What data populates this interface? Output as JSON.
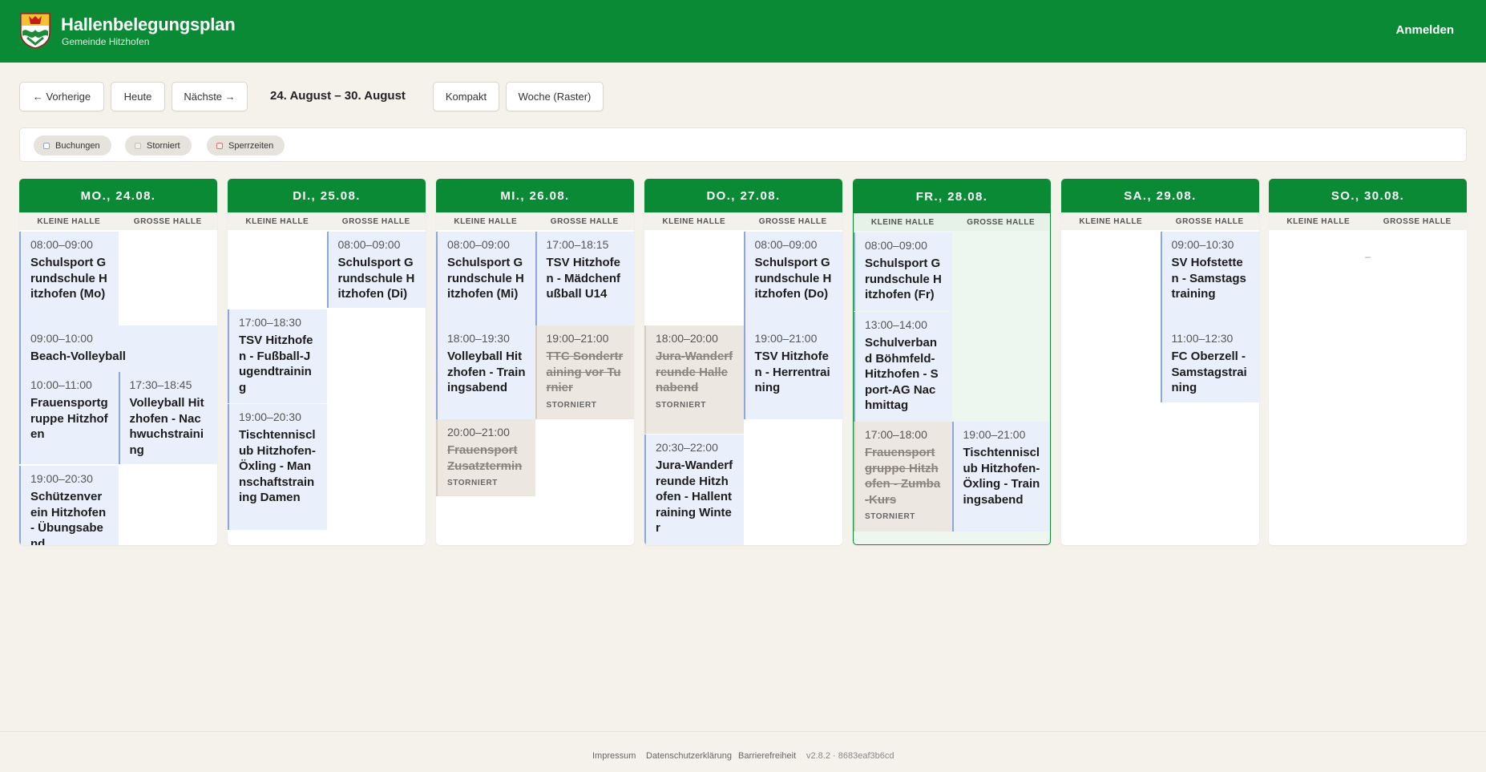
{
  "header": {
    "title": "Hallenbelegungsplan",
    "subtitle": "Gemeinde Hitzhofen",
    "login": "Anmelden",
    "brand_color": "#0a8a35"
  },
  "toolbar": {
    "prev": "← Vorherige",
    "today": "Heute",
    "next": "Nächste →",
    "range": "24. August – 30. August",
    "compact": "Kompakt",
    "week": "Woche (Raster)"
  },
  "legend": {
    "bookings": "Buchungen",
    "cancelled": "Storniert",
    "blocked": "Sperrzeiten"
  },
  "halls": {
    "small": "KLEINE HALLE",
    "large": "GROSSE HALLE"
  },
  "days": [
    {
      "label": "MO., 24.08.",
      "today": false,
      "events": [
        {
          "hall": "kleine",
          "time": "08:00–09:00",
          "name": "Schulsport Grundschule Hitzhofen (Mo)"
        },
        {
          "hall": "beide",
          "time": "09:00–10:00",
          "name": "Beach-Volleyball"
        },
        {
          "hall": "kleine",
          "time": "10:00–11:00",
          "name": "Frauensportgruppe Hitzhofen"
        },
        {
          "hall": "grosse",
          "time": "17:30–18:45",
          "name": "Volleyball Hitzhofen - Nachwuchstraining"
        },
        {
          "hall": "kleine",
          "time": "19:00–20:30",
          "name": "Schützenverein Hitzhofen - Übungsabend"
        }
      ]
    },
    {
      "label": "DI., 25.08.",
      "today": false,
      "events": [
        {
          "hall": "grosse",
          "time": "08:00–09:00",
          "name": "Schulsport Grundschule Hitzhofen (Di)"
        },
        {
          "hall": "kleine",
          "time": "17:00–18:30",
          "name": "TSV Hitzhofen - Fußball-Jugendtraining"
        },
        {
          "hall": "kleine",
          "time": "19:00–20:30",
          "name": "Tischtennisclub Hitzhofen-Öxling - Mannschaftstraining Damen"
        }
      ]
    },
    {
      "label": "MI., 26.08.",
      "today": false,
      "events": [
        {
          "hall": "kleine",
          "time": "08:00–09:00",
          "name": "Schulsport Grundschule Hitzhofen (Mi)"
        },
        {
          "hall": "grosse",
          "time": "17:00–18:15",
          "name": "TSV Hitzhofen - Mädchenfußball U14"
        },
        {
          "hall": "kleine",
          "time": "18:00–19:30",
          "name": "Volleyball Hitzhofen - Trainingsabend"
        },
        {
          "hall": "grosse",
          "time": "19:00–21:00",
          "name": "TTC Sondertraining vor Turnier",
          "status": "STORNIERT"
        },
        {
          "hall": "kleine",
          "time": "20:00–21:00",
          "name": "Frauensport Zusatztermin",
          "status": "STORNIERT"
        }
      ]
    },
    {
      "label": "DO., 27.08.",
      "today": false,
      "events": [
        {
          "hall": "grosse",
          "time": "08:00–09:00",
          "name": "Schulsport Grundschule Hitzhofen (Do)"
        },
        {
          "hall": "kleine",
          "time": "18:00–20:00",
          "name": "Jura-Wanderfreunde Hallenabend",
          "status": "STORNIERT"
        },
        {
          "hall": "grosse",
          "time": "19:00–21:00",
          "name": "TSV Hitzhofen - Herrentraining"
        },
        {
          "hall": "kleine",
          "time": "20:30–22:00",
          "name": "Jura-Wanderfreunde Hitzhofen - Hallentraining Winter"
        }
      ]
    },
    {
      "label": "FR., 28.08.",
      "today": true,
      "events": [
        {
          "hall": "kleine",
          "time": "08:00–09:00",
          "name": "Schulsport Grundschule Hitzhofen (Fr)"
        },
        {
          "hall": "kleine",
          "time": "13:00–14:00",
          "name": "Schulverband Böhmfeld-Hitzhofen - Sport-AG Nachmittag"
        },
        {
          "hall": "kleine",
          "time": "17:00–18:00",
          "name": "Frauensportgruppe Hitzhofen - Zumba-Kurs",
          "status": "STORNIERT"
        },
        {
          "hall": "grosse",
          "time": "19:00–21:00",
          "name": "Tischtennisclub Hitzhofen-Öxling - Trainingsabend"
        }
      ]
    },
    {
      "label": "SA., 29.08.",
      "today": false,
      "events": [
        {
          "hall": "grosse",
          "time": "09:00–10:30",
          "name": "SV Hofstetten - Samstagstraining"
        },
        {
          "hall": "grosse",
          "time": "11:00–12:30",
          "name": "FC Oberzell - Samstagstraining"
        }
      ]
    },
    {
      "label": "SO., 30.08.",
      "today": false,
      "empty": "–",
      "events": []
    }
  ],
  "footer": {
    "impressum": "Impressum",
    "privacy": "Datenschutzerklärung",
    "accessibility": "Barrierefreiheit",
    "version": "v2.8.2 · 8683eaf3b6cd"
  }
}
